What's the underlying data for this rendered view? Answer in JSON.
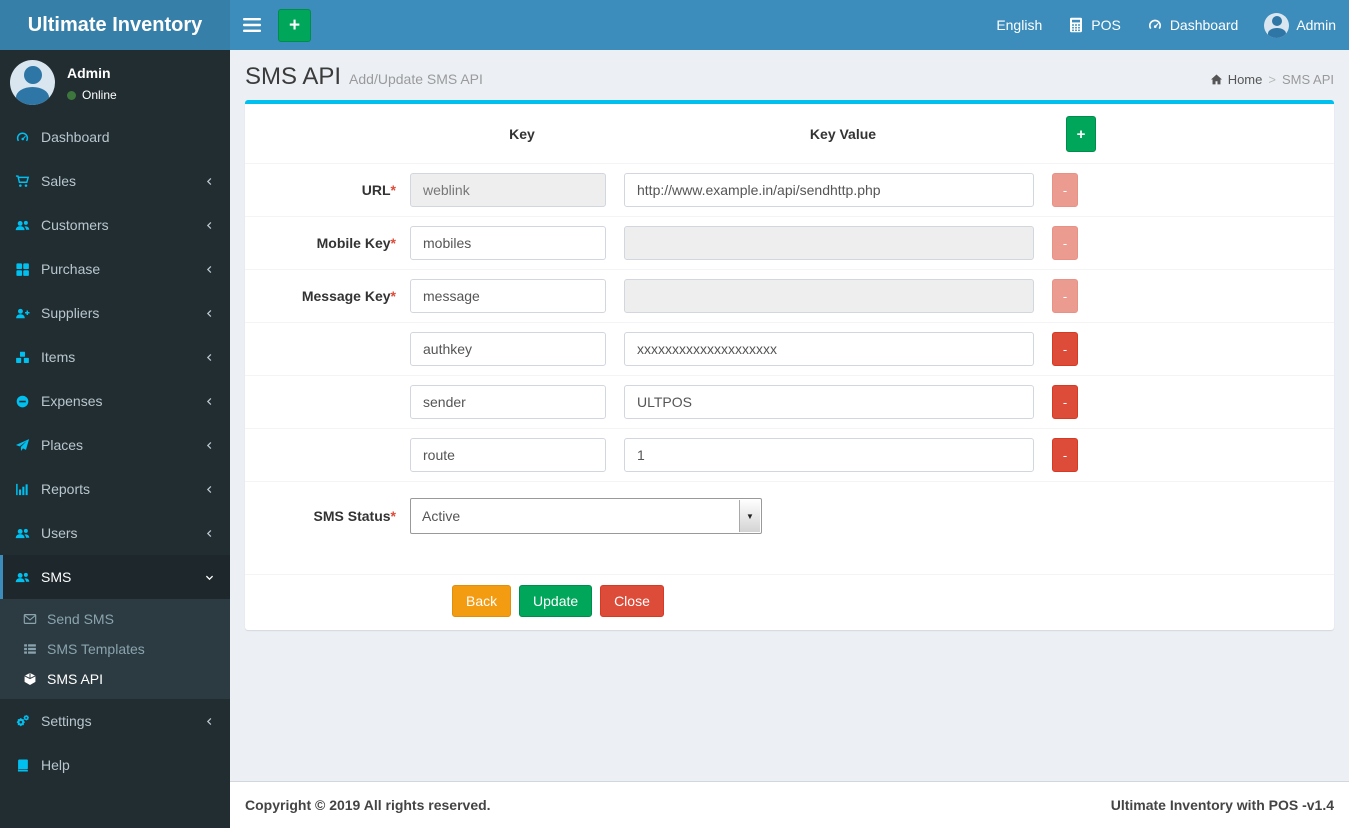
{
  "app": {
    "title": "Ultimate Inventory"
  },
  "navbar": {
    "add_button": "+",
    "language": "English",
    "pos": "POS",
    "dashboard": "Dashboard",
    "user": "Admin"
  },
  "sidebar": {
    "user": {
      "name": "Admin",
      "status": "Online"
    },
    "items": [
      {
        "label": "Dashboard"
      },
      {
        "label": "Sales"
      },
      {
        "label": "Customers"
      },
      {
        "label": "Purchase"
      },
      {
        "label": "Suppliers"
      },
      {
        "label": "Items"
      },
      {
        "label": "Expenses"
      },
      {
        "label": "Places"
      },
      {
        "label": "Reports"
      },
      {
        "label": "Users"
      },
      {
        "label": "SMS",
        "children": [
          {
            "label": "Send SMS"
          },
          {
            "label": "SMS Templates"
          },
          {
            "label": "SMS API"
          }
        ]
      },
      {
        "label": "Settings"
      },
      {
        "label": "Help"
      }
    ]
  },
  "page": {
    "title": "SMS API",
    "subtitle": "Add/Update SMS API",
    "breadcrumb": {
      "home": "Home",
      "separator": ">",
      "current": "SMS API"
    }
  },
  "form": {
    "required_mark": "*",
    "headers": {
      "key": "Key",
      "value": "Key Value"
    },
    "add_label": "+",
    "remove_label": "-",
    "rows": [
      {
        "label": "URL",
        "key": "weblink",
        "value": "http://www.example.in/api/sendhttp.php"
      },
      {
        "label": "Mobile Key",
        "key": "mobiles",
        "value": ""
      },
      {
        "label": "Message Key",
        "key": "message",
        "value": ""
      },
      {
        "label": "",
        "key": "authkey",
        "value": "xxxxxxxxxxxxxxxxxxxx"
      },
      {
        "label": "",
        "key": "sender",
        "value": "ULTPOS"
      },
      {
        "label": "",
        "key": "route",
        "value": "1"
      }
    ],
    "status": {
      "label": "SMS Status",
      "value": "Active"
    },
    "buttons": {
      "back": "Back",
      "update": "Update",
      "close": "Close"
    }
  },
  "footer": {
    "left": "Copyright © 2019 All rights reserved.",
    "right": "Ultimate Inventory with POS -v1.4"
  },
  "colors": {
    "navbar": "#3c8dbc",
    "logo_bg": "#367fa9",
    "sidebar_bg": "#222d32",
    "submenu_bg": "#2c3b41",
    "box_accent": "#00c0ef",
    "icon_accent": "#00c0ef",
    "green": "#00a65a",
    "orange": "#f39c12",
    "red": "#dd4b39"
  }
}
